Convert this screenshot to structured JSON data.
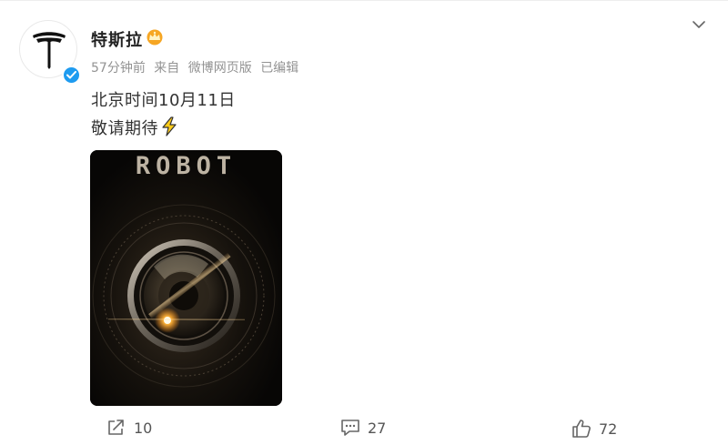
{
  "post": {
    "author": {
      "name": "特斯拉",
      "avatar_icon": "tesla-logo-icon",
      "verified_icon": "verified-check-icon",
      "member_icon": "crown-badge-icon"
    },
    "meta": {
      "time": "57分钟前",
      "source_prefix": "来自",
      "source": "微博网页版",
      "edited": "已编辑"
    },
    "content": {
      "line1": "北京时间10月11日",
      "line2": "敬请期待",
      "emoji_icon": "lightning-icon"
    },
    "media": {
      "title": "ROBOT",
      "description_icon": "camera-lens-icon"
    },
    "actions": {
      "share_count": "10",
      "comment_count": "27",
      "like_count": "72"
    },
    "colors": {
      "verified": "#1e9bf0",
      "member_badge": "#f6a623",
      "muted_text": "#939393"
    }
  }
}
